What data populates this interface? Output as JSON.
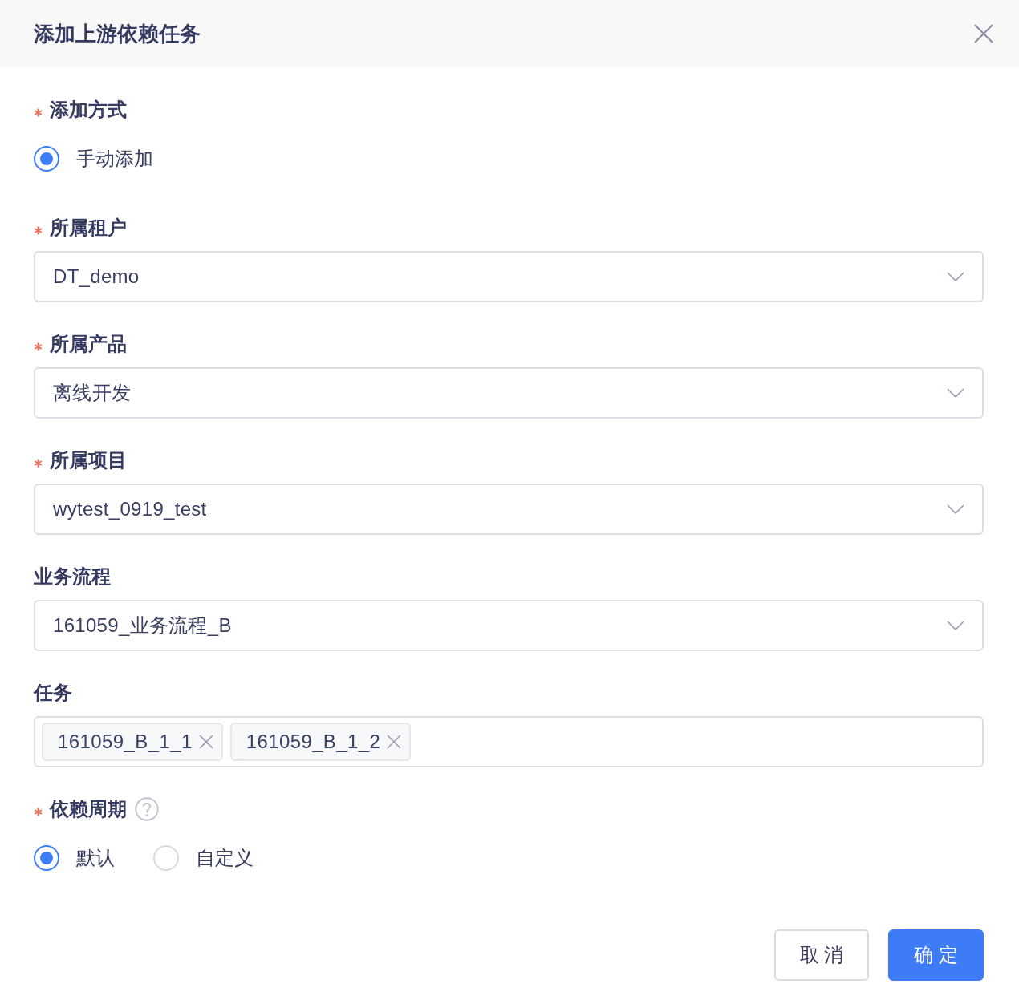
{
  "dialog": {
    "title": "添加上游依赖任务"
  },
  "form": {
    "fields": [
      {
        "kind": "radio",
        "label": "添加方式",
        "required": true,
        "options": [
          {
            "label": "手动添加",
            "selected": true
          }
        ]
      },
      {
        "kind": "select",
        "label": "所属租户",
        "required": true,
        "value": "DT_demo"
      },
      {
        "kind": "select",
        "label": "所属产品",
        "required": true,
        "value": "离线开发"
      },
      {
        "kind": "select",
        "label": "所属项目",
        "required": true,
        "value": "wytest_0919_test"
      },
      {
        "kind": "select",
        "label": "业务流程",
        "required": false,
        "value": "161059_业务流程_B"
      },
      {
        "kind": "tags",
        "label": "任务",
        "required": false,
        "tags": [
          "161059_B_1_1",
          "161059_B_1_2"
        ]
      },
      {
        "kind": "radio",
        "label": "依赖周期",
        "required": true,
        "help": true,
        "options": [
          {
            "label": "默认",
            "selected": true
          },
          {
            "label": "自定义",
            "selected": false
          }
        ]
      }
    ]
  },
  "buttons": [
    {
      "label": "取 消",
      "kind": "default"
    },
    {
      "label": "确 定",
      "kind": "primary"
    }
  ]
}
